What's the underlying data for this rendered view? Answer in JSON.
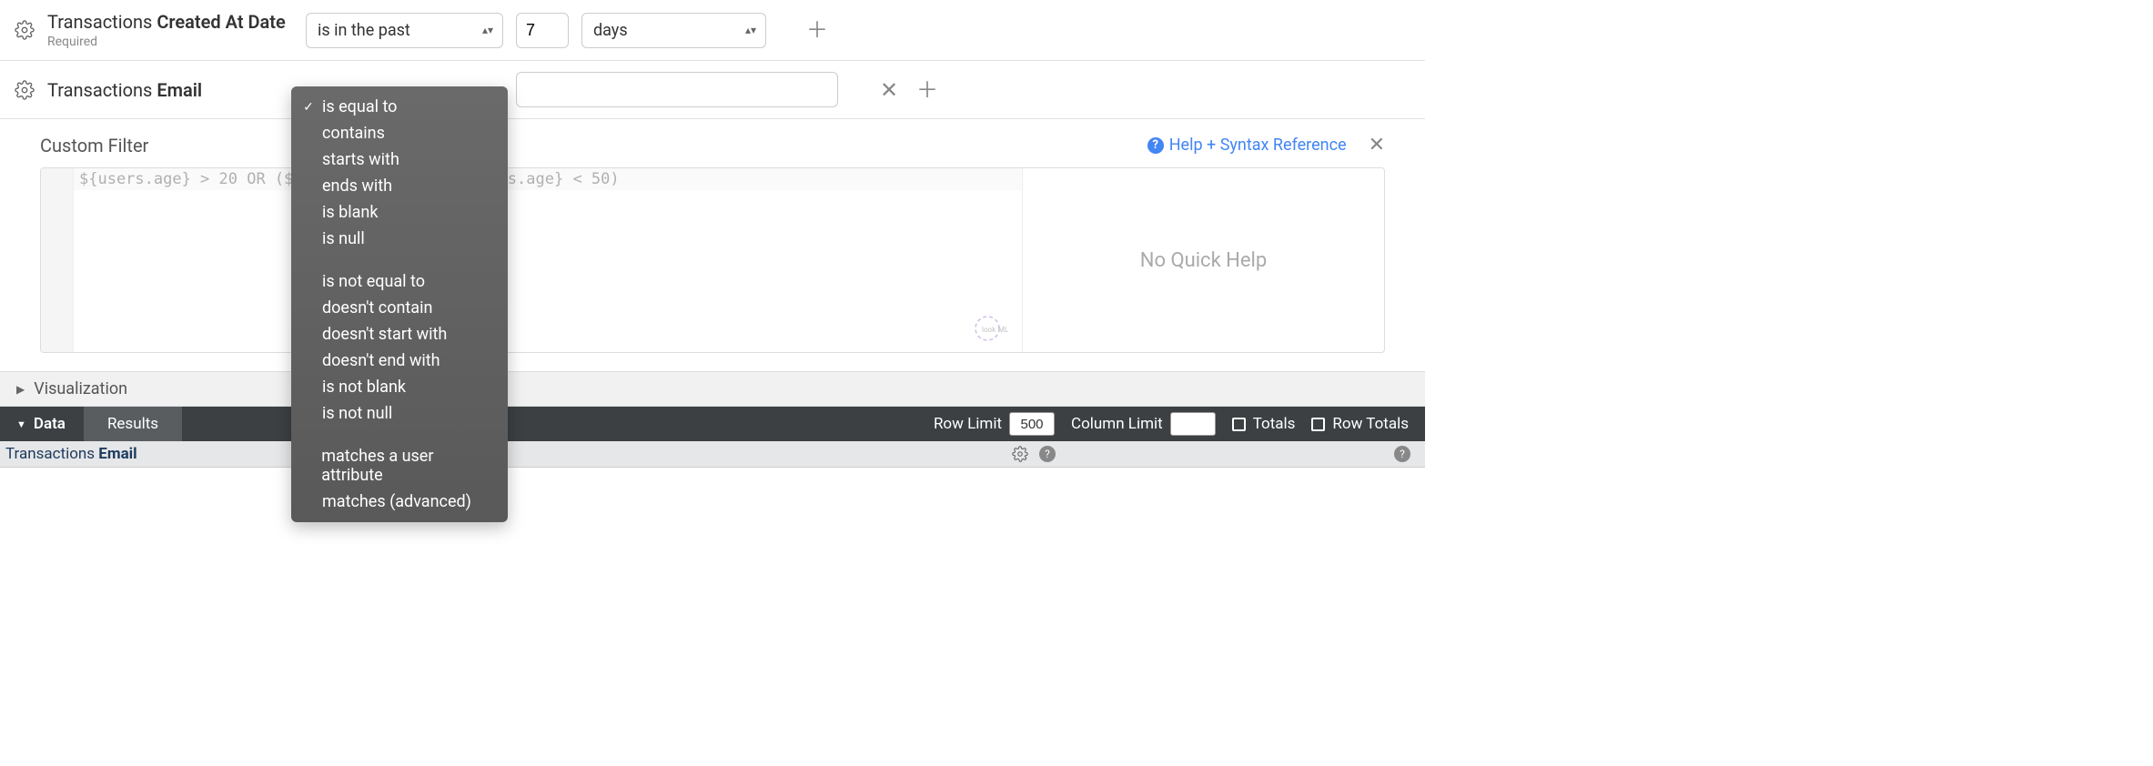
{
  "filters": {
    "created_at": {
      "label_prefix": "Transactions ",
      "label_bold": "Created At Date",
      "required": "Required",
      "operator": "is in the past",
      "value": "7",
      "unit": "days"
    },
    "email": {
      "label_prefix": "Transactions ",
      "label_bold": "Email",
      "value": ""
    }
  },
  "dropdown": {
    "items": [
      "is equal to",
      "contains",
      "starts with",
      "ends with",
      "is blank",
      "is null",
      "is not equal to",
      "doesn't contain",
      "doesn't start with",
      "doesn't end with",
      "is not blank",
      "is not null",
      "matches a user attribute",
      "matches (advanced)"
    ],
    "selected_index": 0,
    "group_breaks": [
      5,
      11
    ]
  },
  "custom_filter": {
    "title": "Custom Filter",
    "help_link": "Help + Syntax Reference",
    "code": "${users.age} > 20 OR (${                ${users.age} < 50)",
    "help_panel": "No Quick Help",
    "watermark": "lookML"
  },
  "visualization": {
    "label": "Visualization"
  },
  "data_bar": {
    "label": "Data",
    "tab": "Results",
    "row_limit_label": "Row Limit",
    "row_limit_value": "500",
    "column_limit_label": "Column Limit",
    "column_limit_value": "",
    "totals_label": "Totals",
    "row_totals_label": "Row Totals"
  },
  "table": {
    "col1_prefix": "Transactions ",
    "col1_bold": "Email"
  }
}
